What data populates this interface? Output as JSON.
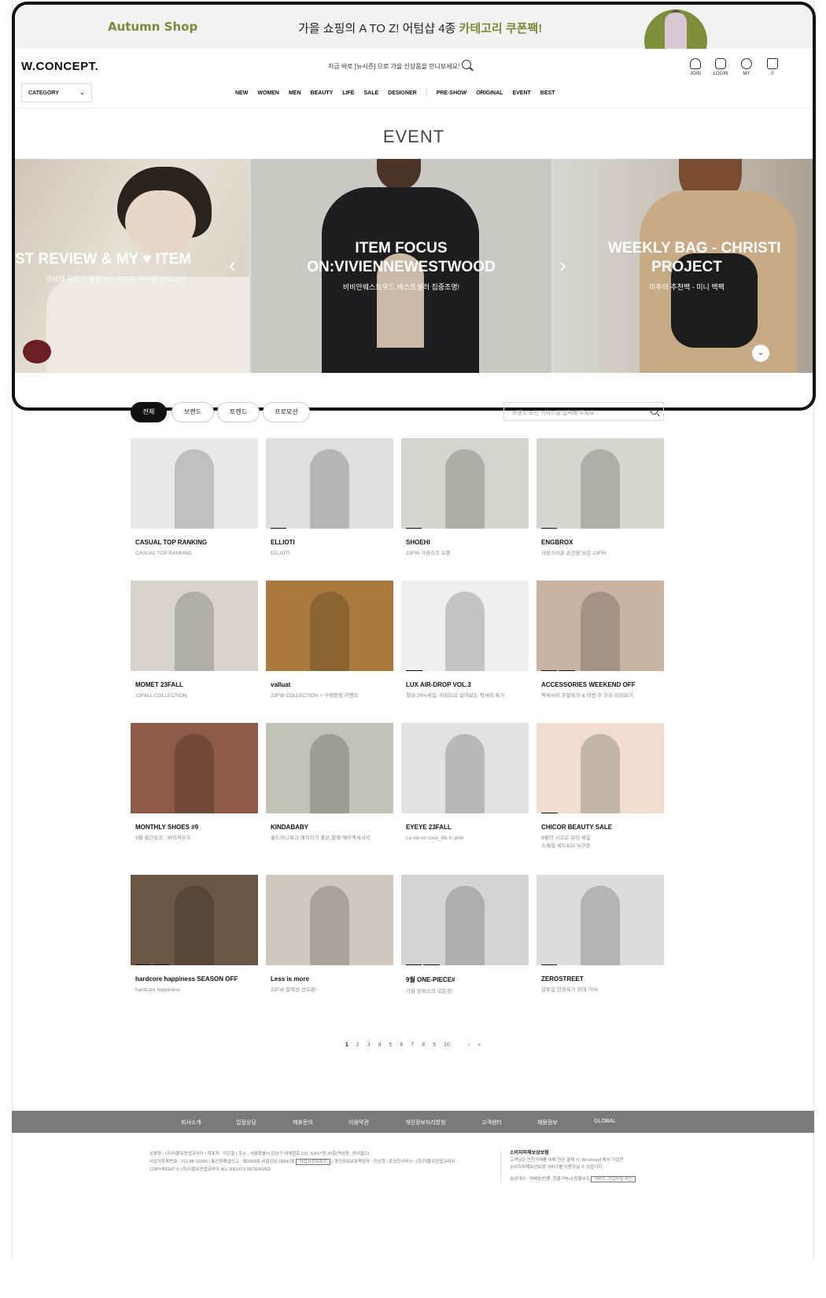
{
  "promo": {
    "brand": "Autumn Shop",
    "message_lead": "가을 쇼핑의 A TO Z! 어텀샵 4종 ",
    "message_accent": "카테고리 쿠폰팩!"
  },
  "header": {
    "logo": "W.CONCEPT.",
    "search_text": "지금 바로 [뉴시즌] 으로 가을 신상품을 만나보세요!",
    "utils": [
      {
        "icon": "join-icon",
        "label": "JOIN"
      },
      {
        "icon": "login-icon",
        "label": "LOGIN"
      },
      {
        "icon": "my-icon",
        "label": "MY"
      },
      {
        "icon": "cart-icon",
        "label": "0"
      }
    ],
    "category_label": "CATEGORY",
    "gnb_left": [
      "NEW",
      "WOMEN",
      "MEN",
      "BEAUTY",
      "LIFE",
      "SALE",
      "DESIGNER"
    ],
    "gnb_right": [
      "PRE-SHOW",
      "ORIGINAL",
      "EVENT",
      "BEST"
    ]
  },
  "event_title": "EVENT",
  "carousel": {
    "slides": [
      {
        "title": "ST REVIEW & MY ♥ ITEM",
        "sub": "리뷰와 하트가 증명하는 라이프 아이템 모아보기!"
      },
      {
        "title": "ITEM FOCUS\nON:VIVIENNEWESTWOOD",
        "title_line1": "ITEM FOCUS",
        "title_line2": "ON:VIVIENNEWESTWOOD",
        "sub": "비비안웨스트우드 베스트셀러 집중조명!"
      },
      {
        "title_line1": "WEEKLY BAG - CHRISTI",
        "title_line2": "PROJECT",
        "sub": "이주의 추천백 - 미니 백팩"
      }
    ],
    "prev_arrow": "‹",
    "next_arrow": "›",
    "scroll_down": "⌄"
  },
  "filters": {
    "chips": [
      "전체",
      "브랜드",
      "트렌드",
      "프로모션"
    ],
    "search_placeholder": "브랜드 또는 키워드를 입력해 주세요."
  },
  "cards": [
    {
      "name": "CASUAL TOP RANKING",
      "desc": "CASUAL TOP RANKING",
      "badges": [],
      "bg": "#e9e9ea"
    },
    {
      "name": "ELLIOTI",
      "desc": "ELLIOTI",
      "badges": [
        "NEW"
      ],
      "bg": "#dedfe1"
    },
    {
      "name": "SHOEHI",
      "desc": "23FW 가을슈즈 오픈",
      "badges": [
        "NEW"
      ],
      "bg": "#d7d4cf"
    },
    {
      "name": "ENGBROX",
      "desc": "사랑스러운 순간을 담은 23FW",
      "badges": [
        "NEW"
      ],
      "bg": "#d9d6d1"
    },
    {
      "name": "MOMET 23FALL",
      "desc": "23FALL COLLECTION",
      "badges": [],
      "bg": "#d8d4cd"
    },
    {
      "name": "valluat",
      "desc": "23FW COLLECTION + 구매증정 이벤트",
      "badges": [],
      "bg": "#a9793f"
    },
    {
      "name": "LUX AIR-DROP VOL.3",
      "desc": "최대 78%세일, 키워드로 알아보는 럭셔리 특가",
      "badges": [
        "SALE"
      ],
      "bg": "#efefef"
    },
    {
      "name": "ACCESSORIES WEEKEND OFF",
      "desc": "액세서리 주말특가 & 이번 주 이슈 모아보기",
      "badges": [
        "NEW",
        "SALE"
      ],
      "bg": "#c9b3a2"
    },
    {
      "name": "MONTHLY SHOES #9",
      "desc": "9월 월간슈즈 : 바이커부츠",
      "badges": [],
      "bg": "#8c5a46"
    },
    {
      "name": "KINDABABY",
      "desc": "울드머니룩과 매치하기 좋은 블랙 헤어액세서리",
      "badges": [],
      "bg": "#c3c1b8"
    },
    {
      "name": "EYEYE 23FALL",
      "desc": "La vie en rose_life in pink",
      "badges": [],
      "bg": "#e4e1e6"
    },
    {
      "name": "CHICOR BEAUTY SALE",
      "desc": "9월의 시코르 뷰티 세일",
      "desc2": "스페셜 세트&20 %쿠폰",
      "badges": [
        "SALE"
      ],
      "bg": "#f0ddd0"
    },
    {
      "name": "hardcore happiness SEASON OFF",
      "desc": "hardcore happiness",
      "badges": [
        "NEW",
        "SALE"
      ],
      "bg": "#6a5644"
    },
    {
      "name": "Less is more",
      "desc": "23FW 컬렉션 선오픈!",
      "badges": [],
      "bg": "#cfc8be"
    },
    {
      "name": "9월 ONE-PIECE#",
      "desc": "가을 원피스의 모든것!",
      "badges": [
        "NEW",
        "SALE"
      ],
      "bg": "#d6d5d2"
    },
    {
      "name": "ZEROSTREET",
      "desc": "금토일 한정특가 최대 70%",
      "badges": [
        "NEW"
      ],
      "bg": "#dedcd8"
    }
  ],
  "pagination": {
    "pages": [
      "1",
      "2",
      "3",
      "4",
      "5",
      "6",
      "7",
      "8",
      "9",
      "10"
    ],
    "current": "1",
    "next": "›",
    "last": "»"
  },
  "footer": {
    "nav": [
      "회사소개",
      "입점상담",
      "제휴문의",
      "이용약관",
      "개인정보처리방침",
      "고객센터",
      "채용정보",
      "GLOBAL"
    ],
    "info_line1": "상호명 : (주)더블유컨셉코리아  |  대표자 : 이은철  |  주소 : 서울특별시 강남구 테헤란로 231, EAST동 20층(역삼동, 센터필드)",
    "info_line2": "사업자등록번호 : 211-88-19183  |  통신판매업신고 : 제2009호-서울강남-00847호",
    "info_line2_btn": "사업자정보확인",
    "info_line2_tail": "  |  개인정보보호책임자 : 이선희  |  호스팅서비스 : (주)더블유컨셉코리아",
    "info_line3": "COPYRIGHT © (주)더블유컨셉코리아 ALL RIGHTS RESERVED",
    "right_head": "소비자피해보상보험",
    "right_line1": "고객님은 안전거래를 위해 현금 결제 시, Wconcept 에서 가입한",
    "right_line2": "소비자피해보상보험 서비스를 이용하실 수 있습니다.",
    "right_line3": "보상대상 : 미배송/반품, 환불거부/쇼핑몰부도",
    "right_btn": "서비스 가입사실 확인"
  }
}
